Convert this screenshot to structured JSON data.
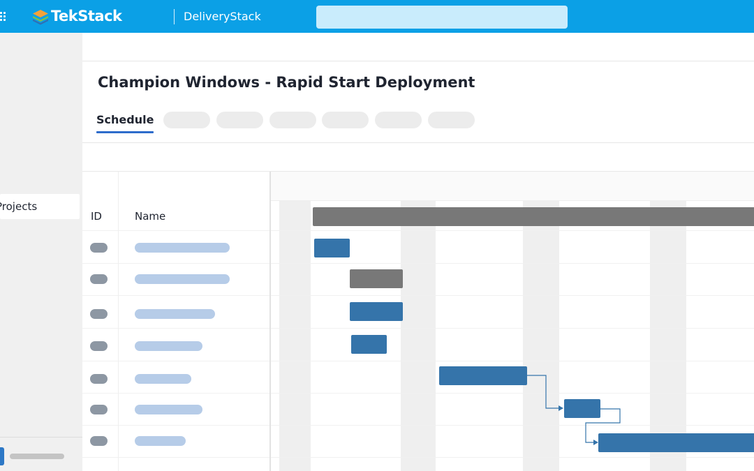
{
  "header": {
    "logo_text": "TekStack",
    "app_name": "DeliveryStack",
    "search_placeholder": ""
  },
  "sidebar": {
    "projects_label": "Projects"
  },
  "project": {
    "title": "Champion Windows - Rapid Start Deployment"
  },
  "tabs": {
    "active_label": "Schedule"
  },
  "grid": {
    "columns": [
      "ID",
      "Name"
    ]
  },
  "colors": {
    "header": "#0ba0e6",
    "task_bar": "#3574aa",
    "summary_bar": "#787878",
    "tab_underline": "#2d6ccb"
  }
}
